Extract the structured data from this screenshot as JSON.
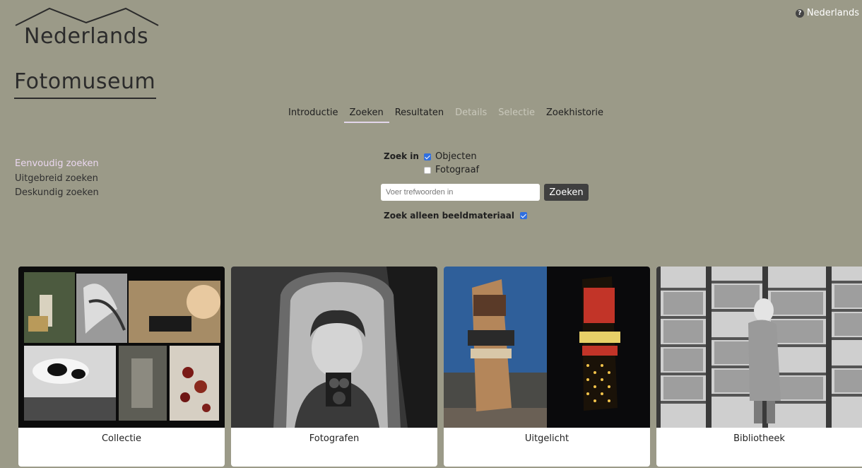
{
  "logo": {
    "line1": "Nederlands",
    "line2": "Fotomuseum"
  },
  "language": {
    "label": "Nederlands",
    "icon": "help-icon"
  },
  "nav": {
    "items": [
      {
        "label": "Introductie",
        "state": "normal"
      },
      {
        "label": "Zoeken",
        "state": "active"
      },
      {
        "label": "Resultaten",
        "state": "normal"
      },
      {
        "label": "Details",
        "state": "disabled"
      },
      {
        "label": "Selectie",
        "state": "disabled"
      },
      {
        "label": "Zoekhistorie",
        "state": "normal"
      }
    ]
  },
  "sidebar": {
    "items": [
      {
        "label": "Eenvoudig zoeken",
        "active": true
      },
      {
        "label": "Uitgebreid zoeken",
        "active": false
      },
      {
        "label": "Deskundig zoeken",
        "active": false
      }
    ]
  },
  "search": {
    "zoek_in_label": "Zoek in",
    "options": [
      {
        "label": "Objecten",
        "checked": true
      },
      {
        "label": "Fotograaf",
        "checked": false
      }
    ],
    "placeholder": "Voer trefwoorden in",
    "value": "",
    "button_label": "Zoeken",
    "image_only_label": "Zoek alleen beeldmateriaal",
    "image_only_checked": true
  },
  "cards": [
    {
      "caption": "Collectie"
    },
    {
      "caption": "Fotografen"
    },
    {
      "caption": "Uitgelicht"
    },
    {
      "caption": "Bibliotheek"
    }
  ],
  "colors": {
    "background": "#9b9a88",
    "active_nav_underline": "#e3d6ea",
    "active_sidebar": "#ead7ef",
    "button": "#3f3f3f",
    "checkbox": "#2f6fe0"
  }
}
